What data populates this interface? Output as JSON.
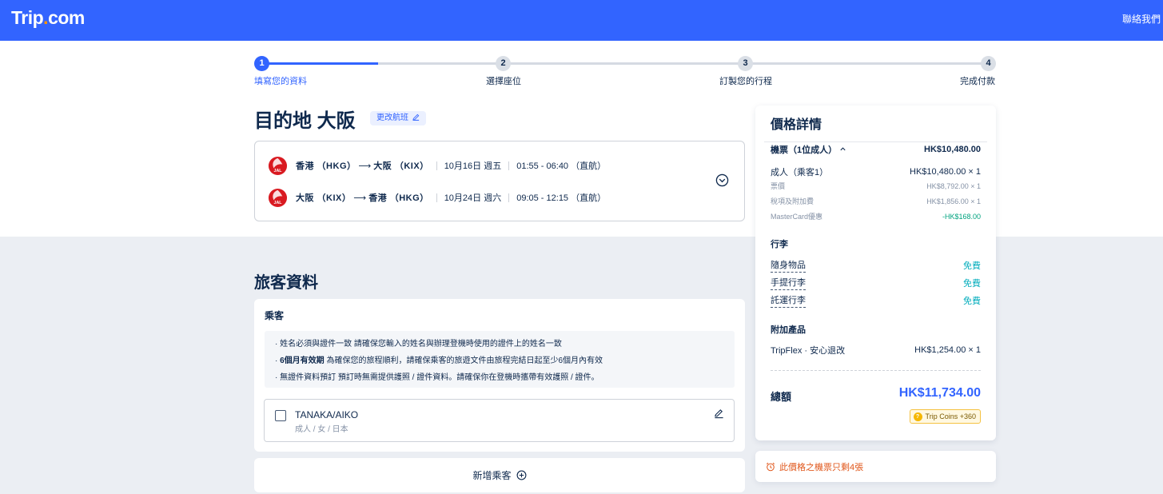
{
  "header": {
    "logo_main": "Trip",
    "logo_dot": ".",
    "logo_end": "com",
    "contact": "聯絡我們"
  },
  "stepper": {
    "progress_fraction": 0.16,
    "steps": [
      {
        "num": "1",
        "label": "填寫您的資料",
        "active": true
      },
      {
        "num": "2",
        "label": "選擇座位",
        "active": false
      },
      {
        "num": "3",
        "label": "訂製您的行程",
        "active": false
      },
      {
        "num": "4",
        "label": "完成付款",
        "active": false
      }
    ]
  },
  "trip": {
    "title": "目的地 大阪",
    "change_flight": "更改航班",
    "flights": [
      {
        "from": "香港 （HKG）",
        "to": "大阪 （KIX）",
        "date": "10月16日 週五",
        "time": "01:55 - 06:40 （直航）"
      },
      {
        "from": "大阪 （KIX）",
        "to": "香港 （HKG）",
        "date": "10月24日 週六",
        "time": "09:05 - 12:15 （直航）"
      }
    ]
  },
  "passengers": {
    "section_title": "旅客資料",
    "card_title": "乘客",
    "notices": [
      {
        "bold": "",
        "text": "· 姓名必須與證件一致 請確保您輸入的姓名與辦理登機時使用的證件上的姓名一致"
      },
      {
        "bold": "6個月有效期",
        "text": " 為確保您的旅程順利，請確保乘客的旅遊文件由旅程完結日起至少6個月內有效"
      },
      {
        "bold": "",
        "text": "· 無證件資料預訂 預訂時無需提供護照 / 證件資料。請確保你在登機時攜帶有效護照 / 證件。"
      }
    ],
    "passenger": {
      "name": "TANAKA/AIKO",
      "details": "成人 / 女 / 日本"
    },
    "add_label": "新增乘客"
  },
  "price": {
    "title": "價格詳情",
    "ticket_label": "機票（1位成人）",
    "ticket_total": "HK$10,480.00",
    "adult_label": "成人（乘客1）",
    "adult_value": "HK$10,480.00 × 1",
    "fare_label": "票價",
    "fare_value": "HK$8,792.00 × 1",
    "tax_label": "稅項及附加費",
    "tax_value": "HK$1,856.00 × 1",
    "discount_label": "MasterCard優惠",
    "discount_value": "-HK$168.00",
    "baggage_title": "行李",
    "baggage": [
      {
        "label": "隨身物品",
        "value": "免費"
      },
      {
        "label": "手提行李",
        "value": "免費"
      },
      {
        "label": "託運行李",
        "value": "免費"
      }
    ],
    "addons_title": "附加產品",
    "addon_label": "TripFlex · 安心退改",
    "addon_value": "HK$1,254.00 × 1",
    "total_label": "總額",
    "total_value": "HK$11,734.00",
    "coins": "Trip Coins +360"
  },
  "alert": "此價格之機票只剩4張",
  "colors": {
    "brand": "#3264ff",
    "alert": "#e0561a",
    "free": "#06aebd"
  }
}
